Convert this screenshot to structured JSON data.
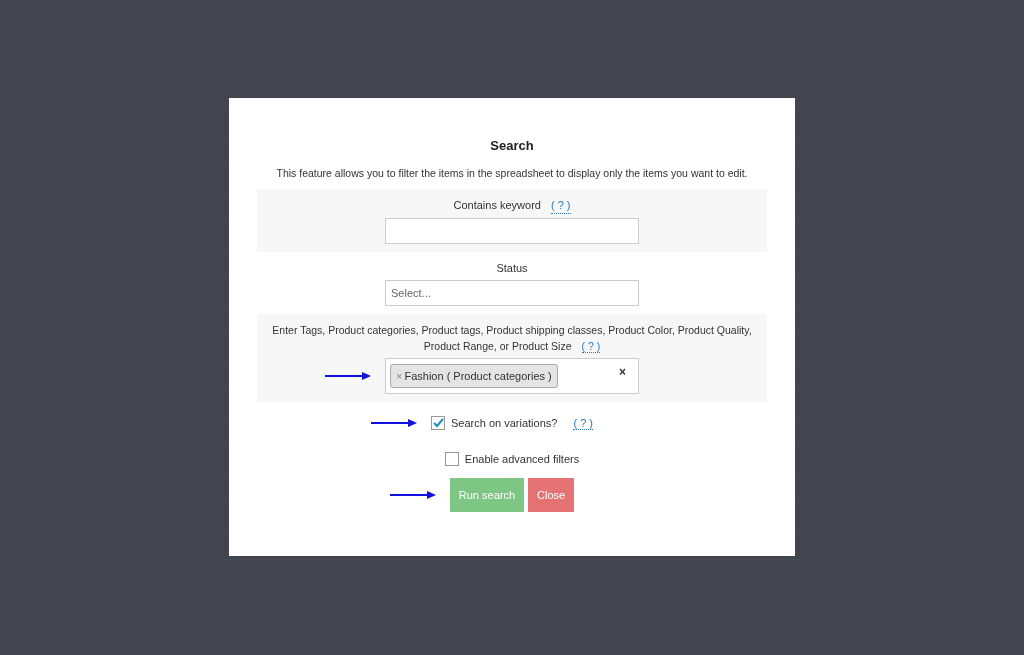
{
  "dialog": {
    "title": "Search",
    "description": "This feature allows you to filter the items in the spreadsheet to display only the items you want to edit.",
    "keyword": {
      "label": "Contains keyword",
      "help": "( ? )"
    },
    "status": {
      "label": "Status",
      "placeholder": "Select..."
    },
    "taxonomy": {
      "label": "Enter Tags, Product categories, Product tags, Product shipping classes, Product Color, Product Quality, Product Range, or Product Size",
      "help": "( ? )",
      "annotated": true,
      "clear": "×",
      "tags": [
        {
          "remove": "×",
          "text": "Fashion ( Product categories )"
        }
      ]
    },
    "options": [
      {
        "label": "Search on variations?",
        "checked": true,
        "help": "( ? )",
        "annotated": true
      },
      {
        "label": "Enable advanced filters",
        "checked": false,
        "annotated": false
      }
    ],
    "buttons": [
      {
        "kind": "primary",
        "label": "Run search",
        "annotated": true
      },
      {
        "kind": "danger",
        "label": "Close",
        "annotated": false
      }
    ]
  }
}
